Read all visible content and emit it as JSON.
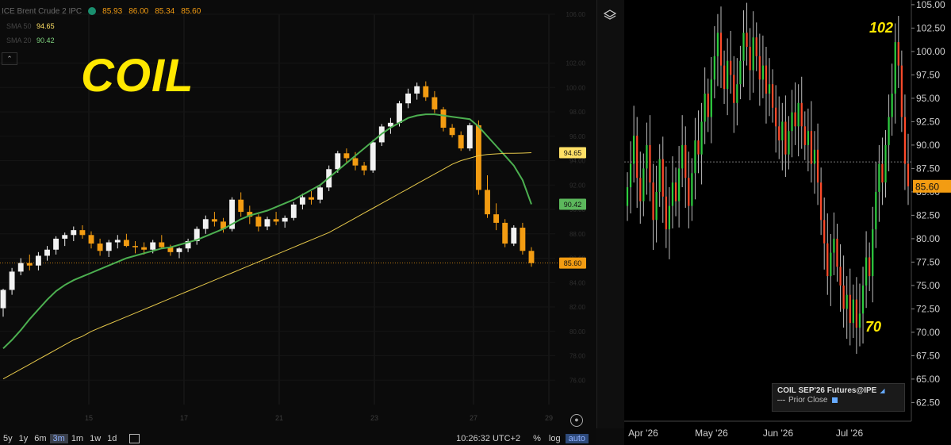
{
  "header": {
    "symbol_label": "ICE Brent Crude 2 IPC",
    "ohlc": [
      "85.93",
      "86.00",
      "85.34",
      "85.60"
    ],
    "ma1_label": "SMA 50",
    "ma1_value": "94.65",
    "ma2_label": "SMA 20",
    "ma2_value": "90.42",
    "title": "COIL"
  },
  "toolbar": {
    "timeframes": [
      "5y",
      "1y",
      "6m",
      "3m",
      "1m",
      "1w",
      "1d"
    ],
    "active_timeframe": "3m",
    "clock": "10:26:32 UTC+2",
    "percent": "%",
    "log": "log",
    "auto": "auto"
  },
  "chart_data": [
    {
      "type": "candlestick",
      "title": "COIL",
      "y_ticks": [
        "106.00",
        "102.00",
        "100.00",
        "98.00",
        "96.00",
        "94.00",
        "92.00",
        "90.00",
        "88.00",
        "86.00",
        "84.00",
        "82.00",
        "80.00",
        "78.00",
        "76.00"
      ],
      "x_ticks": [
        "15",
        "17",
        "21",
        "23",
        "27",
        "29"
      ],
      "last_price": 85.6,
      "price_labels": [
        {
          "label": "94.65",
          "value": 94.65,
          "color": "#ffe066"
        },
        {
          "label": "90.42",
          "value": 90.42,
          "color": "#5cb85c"
        },
        {
          "label": "85.60",
          "value": 85.6,
          "color": "#f39c12"
        }
      ],
      "ylim": [
        74,
        106
      ],
      "candles": [
        [
          81.9,
          83.5,
          81.2,
          83.4
        ],
        [
          83.4,
          85.2,
          83.0,
          84.9
        ],
        [
          84.9,
          86.0,
          84.6,
          85.6
        ],
        [
          85.6,
          86.3,
          85.0,
          85.4
        ],
        [
          85.4,
          86.5,
          85.0,
          86.2
        ],
        [
          86.2,
          87.0,
          85.8,
          86.7
        ],
        [
          86.7,
          87.8,
          86.3,
          87.6
        ],
        [
          87.6,
          88.1,
          87.0,
          87.9
        ],
        [
          87.9,
          88.6,
          87.4,
          88.3
        ],
        [
          88.3,
          88.7,
          87.6,
          87.9
        ],
        [
          87.9,
          88.2,
          86.8,
          87.2
        ],
        [
          87.2,
          87.6,
          86.2,
          86.6
        ],
        [
          86.6,
          87.5,
          86.1,
          87.3
        ],
        [
          87.3,
          87.9,
          86.8,
          87.5
        ],
        [
          87.5,
          88.0,
          86.9,
          87.0
        ],
        [
          87.0,
          87.4,
          86.4,
          86.9
        ],
        [
          86.9,
          87.3,
          86.3,
          86.7
        ],
        [
          86.7,
          87.5,
          86.4,
          87.3
        ],
        [
          87.3,
          87.9,
          86.8,
          86.9
        ],
        [
          86.9,
          87.1,
          86.2,
          86.5
        ],
        [
          86.5,
          86.9,
          86.0,
          86.8
        ],
        [
          86.8,
          87.6,
          86.5,
          87.4
        ],
        [
          87.4,
          88.6,
          87.1,
          88.4
        ],
        [
          88.4,
          89.5,
          88.0,
          89.2
        ],
        [
          89.2,
          89.8,
          88.6,
          89.0
        ],
        [
          89.0,
          89.3,
          88.1,
          88.4
        ],
        [
          88.4,
          91.0,
          88.2,
          90.8
        ],
        [
          90.8,
          91.4,
          89.4,
          89.8
        ],
        [
          89.8,
          90.3,
          88.8,
          89.4
        ],
        [
          89.4,
          89.6,
          88.2,
          88.6
        ],
        [
          88.6,
          89.4,
          88.3,
          89.2
        ],
        [
          89.2,
          89.8,
          88.7,
          89.0
        ],
        [
          89.0,
          89.5,
          88.5,
          89.3
        ],
        [
          89.3,
          90.6,
          89.1,
          90.4
        ],
        [
          90.4,
          91.3,
          90.0,
          91.0
        ],
        [
          91.0,
          91.5,
          90.4,
          90.8
        ],
        [
          90.8,
          92.0,
          90.5,
          91.8
        ],
        [
          91.8,
          93.6,
          91.5,
          93.3
        ],
        [
          93.3,
          94.8,
          93.0,
          94.6
        ],
        [
          94.6,
          95.0,
          93.8,
          94.2
        ],
        [
          94.2,
          94.7,
          93.2,
          93.6
        ],
        [
          93.6,
          93.9,
          92.8,
          93.2
        ],
        [
          93.2,
          95.7,
          93.0,
          95.5
        ],
        [
          95.5,
          97.0,
          95.2,
          96.8
        ],
        [
          96.8,
          97.5,
          96.2,
          97.1
        ],
        [
          97.1,
          98.9,
          96.8,
          98.7
        ],
        [
          98.7,
          99.9,
          98.3,
          99.5
        ],
        [
          99.5,
          100.4,
          99.0,
          100.1
        ],
        [
          100.1,
          100.5,
          98.9,
          99.2
        ],
        [
          99.2,
          99.7,
          97.9,
          98.2
        ],
        [
          98.2,
          98.4,
          96.4,
          96.7
        ],
        [
          96.7,
          97.0,
          95.9,
          96.1
        ],
        [
          96.1,
          96.4,
          94.8,
          95.0
        ],
        [
          95.0,
          97.1,
          94.8,
          96.9
        ],
        [
          96.9,
          97.3,
          91.2,
          91.6
        ],
        [
          91.6,
          92.8,
          89.3,
          89.6
        ],
        [
          89.6,
          90.5,
          88.3,
          88.9
        ],
        [
          88.9,
          89.2,
          86.9,
          87.2
        ],
        [
          87.2,
          88.7,
          87.0,
          88.5
        ],
        [
          88.5,
          88.9,
          86.3,
          86.6
        ],
        [
          86.6,
          86.9,
          85.3,
          85.6
        ]
      ],
      "series": [
        {
          "name": "SMA 20",
          "color": "#4caf50",
          "values": [
            78.6,
            79.3,
            80.1,
            81.0,
            81.8,
            82.6,
            83.3,
            83.8,
            84.2,
            84.5,
            84.8,
            85.1,
            85.4,
            85.7,
            86.0,
            86.2,
            86.4,
            86.6,
            86.8,
            86.9,
            87.1,
            87.3,
            87.5,
            87.8,
            88.1,
            88.4,
            88.8,
            89.2,
            89.5,
            89.7,
            89.9,
            90.2,
            90.5,
            90.8,
            91.2,
            91.6,
            92.0,
            92.6,
            93.2,
            93.8,
            94.4,
            95.0,
            95.6,
            96.2,
            96.7,
            97.1,
            97.5,
            97.7,
            97.8,
            97.8,
            97.7,
            97.6,
            97.5,
            97.4,
            96.8,
            96.0,
            95.2,
            94.4,
            93.6,
            92.4,
            90.42
          ]
        },
        {
          "name": "SMA 50",
          "color": "#e6c84a",
          "values": [
            76.1,
            76.5,
            76.9,
            77.3,
            77.7,
            78.1,
            78.5,
            78.9,
            79.3,
            79.6,
            80.0,
            80.3,
            80.6,
            80.9,
            81.2,
            81.5,
            81.8,
            82.1,
            82.4,
            82.7,
            83.0,
            83.3,
            83.6,
            83.9,
            84.2,
            84.5,
            84.8,
            85.1,
            85.4,
            85.7,
            86.0,
            86.3,
            86.6,
            86.9,
            87.2,
            87.5,
            87.8,
            88.1,
            88.5,
            88.9,
            89.3,
            89.7,
            90.1,
            90.5,
            90.9,
            91.3,
            91.7,
            92.1,
            92.5,
            92.9,
            93.3,
            93.7,
            94.0,
            94.2,
            94.4,
            94.5,
            94.55,
            94.6,
            94.6,
            94.62,
            94.65
          ]
        }
      ]
    },
    {
      "type": "candlestick",
      "title": "COIL SEP'26 Futures@IPE",
      "legend": [
        "COIL SEP'26 Futures@IPE",
        "Prior Close"
      ],
      "y_ticks": [
        "105.00",
        "102.50",
        "100.00",
        "97.50",
        "95.00",
        "92.50",
        "90.00",
        "87.50",
        "85.00",
        "82.50",
        "80.00",
        "77.50",
        "75.00",
        "72.50",
        "70.00",
        "67.50",
        "65.00",
        "62.50"
      ],
      "x_ticks": [
        "Apr '26",
        "May '26",
        "Jun '26",
        "Jul '26"
      ],
      "ylim": [
        60.5,
        105.5
      ],
      "prior_close": 88.2,
      "last_price": "85.60",
      "annotations": [
        {
          "text": "102",
          "value": 102
        },
        {
          "text": "70",
          "value": 70
        }
      ],
      "closes": [
        85.5,
        88.0,
        91.0,
        86.5,
        84.0,
        87.5,
        90.0,
        86.0,
        82.0,
        85.0,
        88.5,
        84.5,
        81.0,
        83.5,
        86.0,
        84.0,
        87.5,
        90.0,
        86.5,
        83.5,
        87.0,
        90.5,
        89.0,
        92.5,
        95.5,
        93.0,
        97.0,
        99.5,
        102.0,
        98.5,
        96.0,
        99.0,
        97.5,
        94.5,
        96.5,
        99.0,
        102.0,
        100.5,
        98.0,
        101.5,
        99.5,
        97.0,
        98.5,
        95.5,
        96.5,
        94.0,
        92.0,
        90.5,
        92.5,
        89.0,
        91.5,
        93.5,
        92.0,
        94.5,
        92.0,
        90.0,
        91.5,
        88.0,
        89.5,
        86.0,
        82.0,
        79.5,
        76.0,
        78.5,
        80.0,
        77.0,
        75.0,
        72.5,
        74.0,
        71.0,
        73.5,
        70.5,
        72.0,
        75.0,
        78.0,
        76.0,
        81.0,
        85.0,
        88.0,
        86.0,
        90.0,
        93.0,
        95.5,
        101.0,
        98.5,
        93.0,
        88.0,
        85.6
      ]
    }
  ]
}
